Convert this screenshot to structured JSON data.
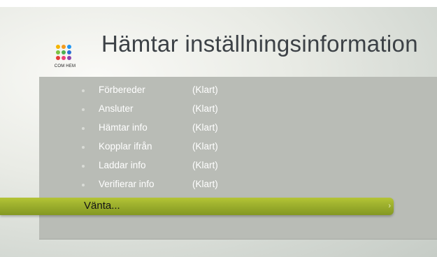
{
  "logo": {
    "text": "COM HEM",
    "dot_colors": [
      "#f4b400",
      "#f39b1e",
      "#2196f3",
      "#7dc242",
      "#4caf50",
      "#2a6fd6",
      "#e53935",
      "#ec407a",
      "#8e44ad"
    ]
  },
  "header": {
    "title": "Hämtar inställningsinformation"
  },
  "steps": [
    {
      "label": "Förbereder",
      "status": "(Klart)"
    },
    {
      "label": "Ansluter",
      "status": "(Klart)"
    },
    {
      "label": "Hämtar info",
      "status": "(Klart)"
    },
    {
      "label": "Kopplar ifrån",
      "status": "(Klart)"
    },
    {
      "label": "Laddar info",
      "status": "(Klart)"
    },
    {
      "label": "Verifierar info",
      "status": "(Klart)"
    }
  ],
  "wait_item": {
    "label": "Vänta...",
    "icon": "chevron-right-icon"
  },
  "colors": {
    "accent": "#9aad2c",
    "panel": "#b9bcb6",
    "title": "#3c4146"
  }
}
